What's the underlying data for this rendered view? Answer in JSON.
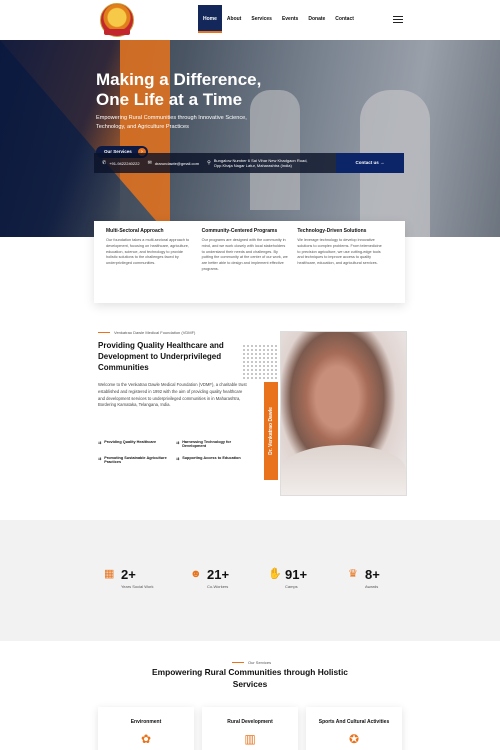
{
  "nav": {
    "items": [
      "Home",
      "About",
      "Services",
      "Events",
      "Donate",
      "Contact"
    ],
    "active": "Home"
  },
  "hero": {
    "title_line1": "Making a Difference,",
    "title_line2": "One Life at a Time",
    "subtitle": "Empowering Rural Communities through Innovative Science, Technology, and Agriculture Practices",
    "cta": "Our Services",
    "cta_arrow": "›"
  },
  "contact_bar": {
    "phone": "+91-9422240222",
    "email": "drarundawle@gmail.com",
    "address": "Bungalow Number 6 Sai Vihar New Khadgaon Road, Opp.Khaja Nagar Latur, Maharashtra (India)",
    "button": "Contact us →"
  },
  "features": [
    {
      "title": "Multi-Sectoral Approach",
      "text": "Our foundation takes a multi-sectoral approach to development, focusing on healthcare, agriculture, education, science, and technology to provide holistic solutions to the challenges faced by underprivileged communities."
    },
    {
      "title": "Community-Centered Programs",
      "text": "Our programs are designed with the community in mind, and we work closely with local stakeholders to understand their needs and challenges. By putting the community at the center of our work, we are better able to design and implement effective programs."
    },
    {
      "title": "Technology-Driven Solutions",
      "text": "We leverage technology to develop innovative solutions to complex problems. From telemedicine to precision agriculture, we use cutting-edge tools and techniques to improve access to quality healthcare, education, and agricultural services."
    }
  ],
  "about": {
    "eyebrow": "Venkatrao Dawle Medical Foundation (VDMF)",
    "heading": "Providing Quality Healthcare and Development to Underprivileged Communities",
    "body": "Welcome to the Venkatrao Dawle Medical Foundation (VDMF), a charitable trust established and registered in 1992 with the aim of providing quality healthcare and development services to underprivileged communities in in Maharashtra, Bordering Karnataka, Telangana, India.",
    "checks": [
      "Providing Quality Healthcare",
      "Harnessing Technology for Development",
      "Promoting Sustainable Agriculture Practices",
      "Supporting Access to Education"
    ],
    "badge": "Dr. Venkatrao Dawle"
  },
  "stats": [
    {
      "num": "2+",
      "label": "Years Social Work",
      "icon": "calendar-icon"
    },
    {
      "num": "21+",
      "label": "Co-Workers",
      "icon": "people-icon"
    },
    {
      "num": "91+",
      "label": "Camps",
      "icon": "handshake-icon"
    },
    {
      "num": "8+",
      "label": "Awards",
      "icon": "trophy-icon"
    }
  ],
  "services": {
    "eyebrow": "Our Services",
    "heading": "Empowering Rural Communities through Holistic Services",
    "cards": [
      {
        "title": "Environment",
        "icon": "leaf-icon"
      },
      {
        "title": "Rural Development",
        "icon": "building-icon"
      },
      {
        "title": "Sports And Cultural Activities",
        "icon": "award-icon"
      }
    ]
  },
  "colors": {
    "accent": "#e8731c",
    "navy": "#0c1a44"
  }
}
